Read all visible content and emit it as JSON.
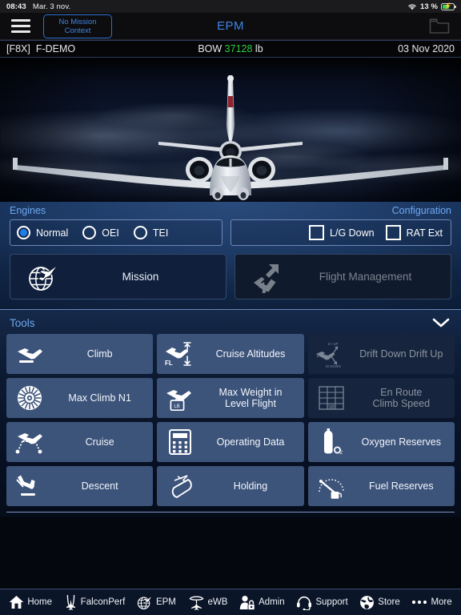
{
  "status_bar": {
    "time": "08:43",
    "date": "Mar. 3 nov.",
    "wifi_icon": "wifi-icon",
    "battery_percent": "13 %",
    "battery_icon": "battery-charging-icon"
  },
  "app_bar": {
    "menu_icon": "hamburger-menu-icon",
    "mission_context_label": "No Mission\nContext",
    "title": "EPM",
    "folder_icon": "folder-icon"
  },
  "info_bar": {
    "aircraft": "[F8X]  F-DEMO",
    "bow_label": "BOW",
    "bow_value": "37128",
    "bow_unit": "lb",
    "bow_value_color": "#2ecc40",
    "date": "03 Nov 2020"
  },
  "hero": {
    "image_alt": "falcon-business-jet-front-view-over-clouds"
  },
  "engines": {
    "title": "Engines",
    "options": [
      {
        "label": "Normal",
        "selected": true
      },
      {
        "label": "OEI",
        "selected": false
      },
      {
        "label": "TEI",
        "selected": false
      }
    ]
  },
  "configuration": {
    "title": "Configuration",
    "options": [
      {
        "label": "L/G Down",
        "checked": false
      },
      {
        "label": "RAT Ext",
        "checked": false
      }
    ]
  },
  "primary_buttons": [
    {
      "label": "Mission",
      "icon": "globe-plane-icon",
      "enabled": true
    },
    {
      "label": "Flight Management",
      "icon": "plane-takeoff-arrow-icon",
      "enabled": false
    }
  ],
  "tools": {
    "title": "Tools",
    "collapse_icon": "chevron-down-icon",
    "items": [
      {
        "label": "Climb",
        "icon": "plane-climb-icon",
        "enabled": true
      },
      {
        "label": "Cruise Altitudes",
        "icon": "flight-level-arrows-icon",
        "enabled": true
      },
      {
        "label": "Drift Down Drift Up",
        "icon": "drift-down-drift-up-icon",
        "enabled": false
      },
      {
        "label": "Max Climb N1",
        "icon": "turbine-fan-icon",
        "enabled": true
      },
      {
        "label": "Max Weight in\nLevel Flight",
        "icon": "plane-weight-icon",
        "enabled": true
      },
      {
        "label": "En Route\nClimb Speed",
        "icon": "grid-table-vi-icon",
        "enabled": false
      },
      {
        "label": "Cruise",
        "icon": "cruise-profile-icon",
        "enabled": true
      },
      {
        "label": "Operating Data",
        "icon": "calculator-icon",
        "enabled": true
      },
      {
        "label": "Oxygen Reserves",
        "icon": "oxygen-bottle-icon",
        "enabled": true
      },
      {
        "label": "Descent",
        "icon": "plane-descent-icon",
        "enabled": true
      },
      {
        "label": "Holding",
        "icon": "holding-pattern-icon",
        "enabled": true
      },
      {
        "label": "Fuel Reserves",
        "icon": "fuel-gauge-icon",
        "enabled": true
      }
    ]
  },
  "tab_bar": [
    {
      "label": "Home",
      "icon": "home-icon"
    },
    {
      "label": "FalconPerf",
      "icon": "falcon-perf-icon"
    },
    {
      "label": "EPM",
      "icon": "globe-plane-icon"
    },
    {
      "label": "eWB",
      "icon": "ewb-plane-icon"
    },
    {
      "label": "Admin",
      "icon": "user-lock-icon"
    },
    {
      "label": "Support",
      "icon": "headset-icon"
    },
    {
      "label": "Store",
      "icon": "globe-icon"
    },
    {
      "label": "More",
      "icon": "ellipsis-icon"
    }
  ]
}
